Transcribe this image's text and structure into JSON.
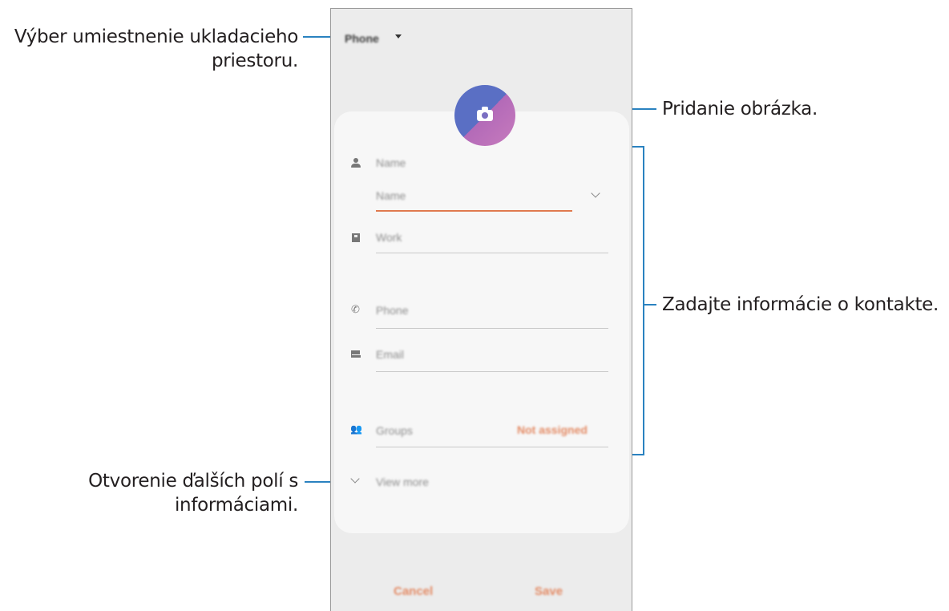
{
  "callouts": {
    "storage": "Výber umiestnenie ukladacieho priestoru.",
    "storage_line1": "Výber umiestnenie ukladacieho",
    "storage_line2": "priestoru.",
    "picture": "Pridanie obrázka.",
    "info": "Zadajte informácie o kontakte.",
    "more_line1": "Otvorenie ďalších polí s",
    "more_line2": "informáciami."
  },
  "phone": {
    "storage_selector": "Phone",
    "fields": {
      "name_header": "Name",
      "name_input": "Name",
      "work": "Work",
      "phone": "Phone",
      "email": "Email",
      "groups": "Groups",
      "groups_value": "Not assigned",
      "view_more": "View more"
    },
    "buttons": {
      "cancel": "Cancel",
      "save": "Save"
    }
  },
  "icons": {
    "caret": "caret-down-icon",
    "camera": "camera-icon",
    "person": "person-icon",
    "building": "building-icon",
    "phone": "phone-icon",
    "email": "mail-icon",
    "groups": "group-icon",
    "chevron": "chevron-down-icon"
  },
  "colors": {
    "callout_line": "#2a82c0",
    "accent": "#e38a64",
    "avatar_blue": "#5a6fc4",
    "avatar_pink": "#c77bbd"
  }
}
